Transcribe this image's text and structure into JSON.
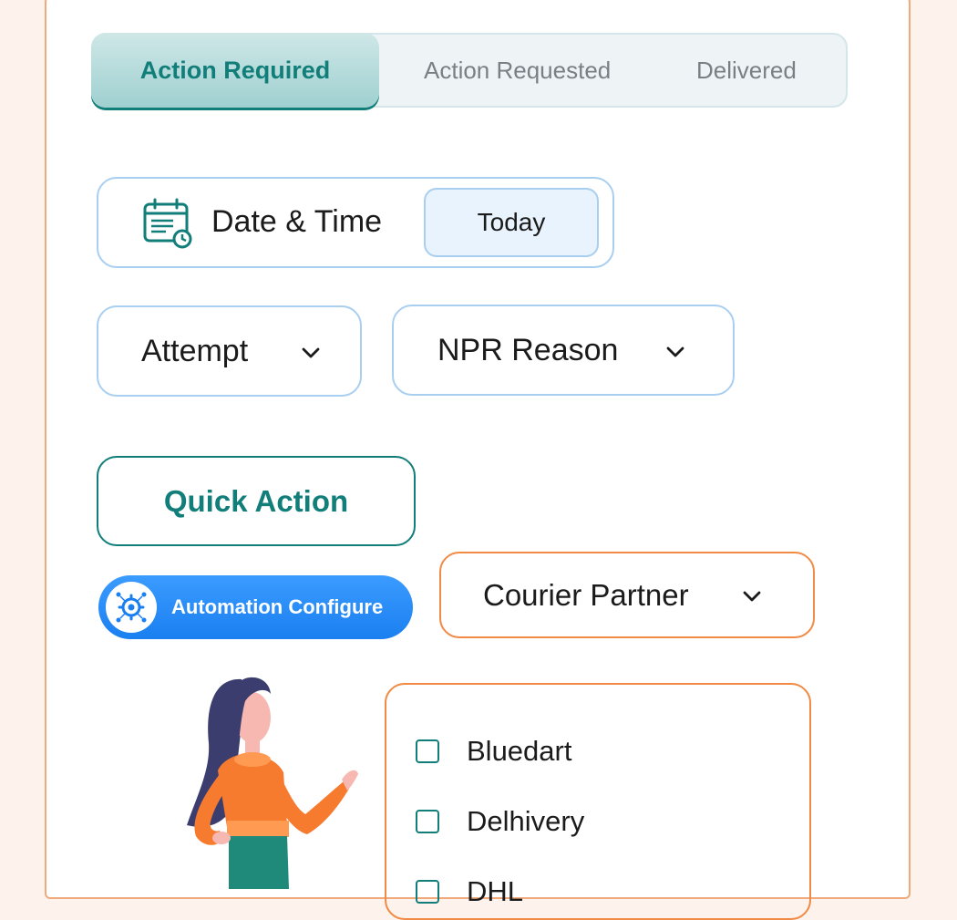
{
  "tabs": [
    {
      "label": "Action Required",
      "active": true
    },
    {
      "label": "Action Requested",
      "active": false
    },
    {
      "label": "Delivered",
      "active": false
    }
  ],
  "date_filter": {
    "icon": "calendar-clock-icon",
    "label": "Date & Time",
    "value": "Today"
  },
  "filters": {
    "attempt": {
      "label": "Attempt",
      "icon": "chevron-down-icon"
    },
    "npr_reason": {
      "label": "NPR Reason",
      "icon": "chevron-down-icon"
    }
  },
  "quick_action": {
    "label": "Quick Action"
  },
  "automation": {
    "label": "Automation Configure",
    "icon": "automation-gear-icon"
  },
  "courier": {
    "label": "Courier Partner",
    "icon": "chevron-down-icon",
    "options": [
      "Bluedart",
      "Delhivery",
      "DHL"
    ]
  },
  "colors": {
    "teal": "#127e7a",
    "blue_border": "#a9cff0",
    "orange": "#f08a45",
    "automation_blue": "#1a7ff0",
    "background": "#fdf3ec"
  }
}
